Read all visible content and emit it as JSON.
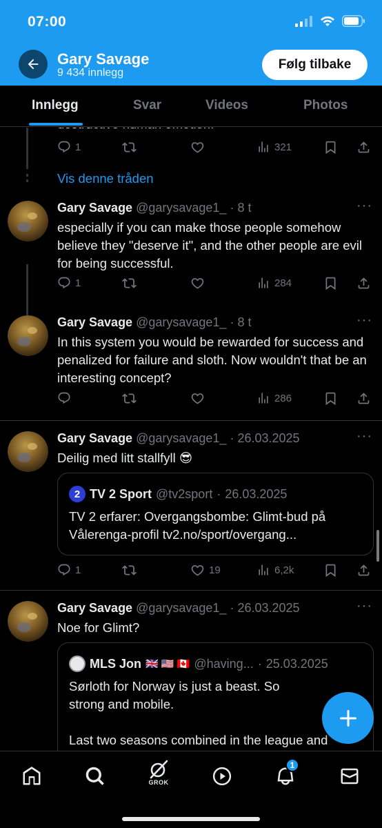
{
  "status_bar": {
    "time": "07:00"
  },
  "header": {
    "name": "Gary Savage",
    "post_count": "9 434 innlegg",
    "follow_label": "Følg tilbake"
  },
  "tabs": [
    {
      "label": "Innlegg",
      "active": true
    },
    {
      "label": "Svar",
      "active": false
    },
    {
      "label": "Videos",
      "active": false
    },
    {
      "label": "Photos",
      "active": false
    }
  ],
  "partial_tweet": {
    "cut_text": "destructive human emotion.",
    "actions": {
      "replies": "1",
      "reposts": "",
      "likes": "",
      "views": "321"
    }
  },
  "show_thread_label": "Vis denne tråden",
  "tweets": [
    {
      "name": "Gary Savage",
      "handle": "@garysavage1_",
      "dot": "·",
      "time": "8 t",
      "text": "especially if you can make those people somehow believe they \"deserve it\", and the other people are evil for being successful.",
      "actions": {
        "replies": "1",
        "reposts": "",
        "likes": "",
        "views": "284"
      }
    },
    {
      "name": "Gary Savage",
      "handle": "@garysavage1_",
      "dot": "·",
      "time": "8 t",
      "text": "In this system you would be rewarded for success and penalized for failure and sloth. Now wouldn't that be an interesting concept?",
      "actions": {
        "replies": "",
        "reposts": "",
        "likes": "",
        "views": "286"
      }
    },
    {
      "name": "Gary Savage",
      "handle": "@garysavage1_",
      "dot": "·",
      "time": "26.03.2025",
      "text": "Deilig med litt stallfyll 😎",
      "quote": {
        "avatar_glyph": "2",
        "name": "TV 2 Sport",
        "handle": "@tv2sport",
        "dot": "·",
        "time": "26.03.2025",
        "text": "TV 2 erfarer: Overgangsbombe: Glimt-bud på Vålerenga-profil tv2.no/sport/overgang..."
      },
      "actions": {
        "replies": "1",
        "reposts": "",
        "likes": "19",
        "views": "6,2k"
      }
    },
    {
      "name": "Gary Savage",
      "handle": "@garysavage1_",
      "dot": "·",
      "time": "26.03.2025",
      "text": "Noe for Glimt?",
      "quote": {
        "name": "MLS Jon",
        "flags": "🇬🇧 🇺🇸 🇨🇦",
        "handle": "@having...",
        "dot": "·",
        "time": "25.03.2025",
        "text_line1": "Sørloth for Norway is just a beast. So strong and mobile.",
        "text_line2": "Last two seasons combined in the league and"
      }
    }
  ],
  "bottom_nav": {
    "grok_label": "GROK",
    "notification_count": "1"
  },
  "colors": {
    "accent": "#1d9bf0",
    "background": "#000000",
    "text": "#e7e9ea",
    "muted": "#71767b",
    "divider": "#2f3336"
  }
}
